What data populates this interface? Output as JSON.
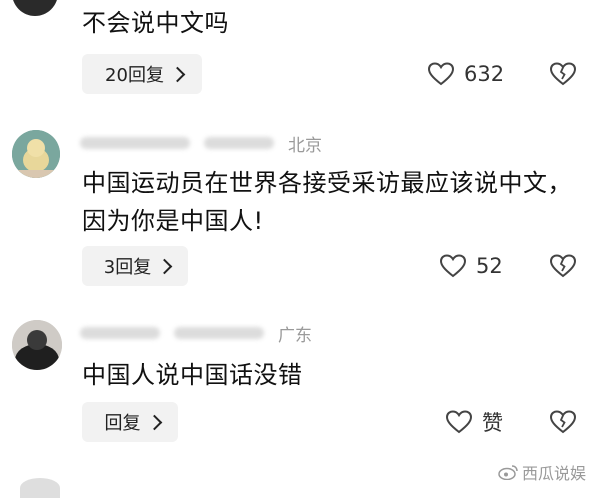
{
  "comments": [
    {
      "location": "",
      "text": "不会说中文吗",
      "reply_label": "20回复",
      "likes": "632"
    },
    {
      "location": "北京",
      "text": "中国运动员在世界各接受采访最应该说中文，因为你是中国人!",
      "reply_label": "3回复",
      "likes": "52"
    },
    {
      "location": "广东",
      "text": "中国人说中国话没错",
      "reply_label": "回复",
      "likes": "赞"
    }
  ],
  "watermark": "西瓜说娱",
  "colors": {
    "background": "#ffffff",
    "reply_bg": "#f2f2f2",
    "meta_gray": "#9a9a9a"
  }
}
